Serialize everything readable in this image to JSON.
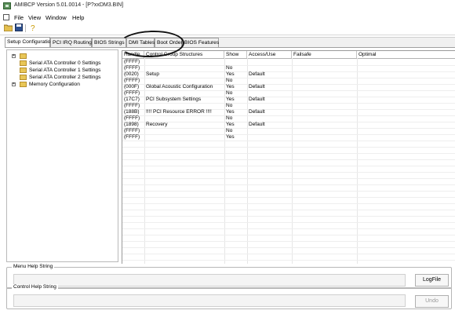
{
  "window": {
    "title": "AMIBCP Version 5.01.0014 - [P?xxDM3.BIN]"
  },
  "menu": [
    "File",
    "View",
    "Window",
    "Help"
  ],
  "toolbar": {
    "buttons": [
      "open-icon",
      "save-icon",
      "help-icon"
    ]
  },
  "tabs": [
    {
      "label": "Setup Configuration",
      "active": true
    },
    {
      "label": "PCI IRQ Routing",
      "active": false
    },
    {
      "label": "BIOS Strings",
      "active": false
    },
    {
      "label": "DMI Tables",
      "active": false
    },
    {
      "label": "Boot Order",
      "active": false
    },
    {
      "label": "BIOS Features",
      "active": false
    }
  ],
  "tree": [
    {
      "label": "",
      "expander": "+"
    },
    {
      "label": "Serial ATA Controller 0 Settings",
      "expander": ""
    },
    {
      "label": "Serial ATA Controller 1 Settings",
      "expander": ""
    },
    {
      "label": "Serial ATA Controller 2 Settings",
      "expander": ""
    },
    {
      "label": "Memory Configuration",
      "expander": "+"
    }
  ],
  "grid": {
    "columns": [
      "Handle",
      "Control Group Structures",
      "Show",
      "Access/Use",
      "Failsafe",
      "Optimal"
    ],
    "rows": [
      [
        "(FFFF)",
        "",
        "",
        "",
        "",
        ""
      ],
      [
        "(FFFF)",
        "",
        "No",
        "",
        "",
        ""
      ],
      [
        "(0020)",
        "Setup",
        "Yes",
        "Default",
        "",
        ""
      ],
      [
        "(FFFF)",
        "",
        "No",
        "",
        "",
        ""
      ],
      [
        "(000F)",
        "Global Acoustic Configuration",
        "Yes",
        "Default",
        "",
        ""
      ],
      [
        "(FFFF)",
        "",
        "No",
        "",
        "",
        ""
      ],
      [
        "(17C7)",
        "PCI Subsystem Settings",
        "Yes",
        "Default",
        "",
        ""
      ],
      [
        "(FFFF)",
        "",
        "No",
        "",
        "",
        ""
      ],
      [
        "(188B)",
        "!!!! PCI Resource ERROR !!!!",
        "Yes",
        "Default",
        "",
        ""
      ],
      [
        "(FFFF)",
        "",
        "No",
        "",
        "",
        ""
      ],
      [
        "(1898)",
        "Recovery",
        "Yes",
        "Default",
        "",
        ""
      ],
      [
        "(FFFF)",
        "",
        "No",
        "",
        "",
        ""
      ],
      [
        "(FFFF)",
        "",
        "Yes",
        "",
        "",
        ""
      ]
    ]
  },
  "menu_help": {
    "label": "Menu Help String",
    "button": "LogFile"
  },
  "control_help": {
    "label": "Control Help String",
    "button": "Undo"
  }
}
